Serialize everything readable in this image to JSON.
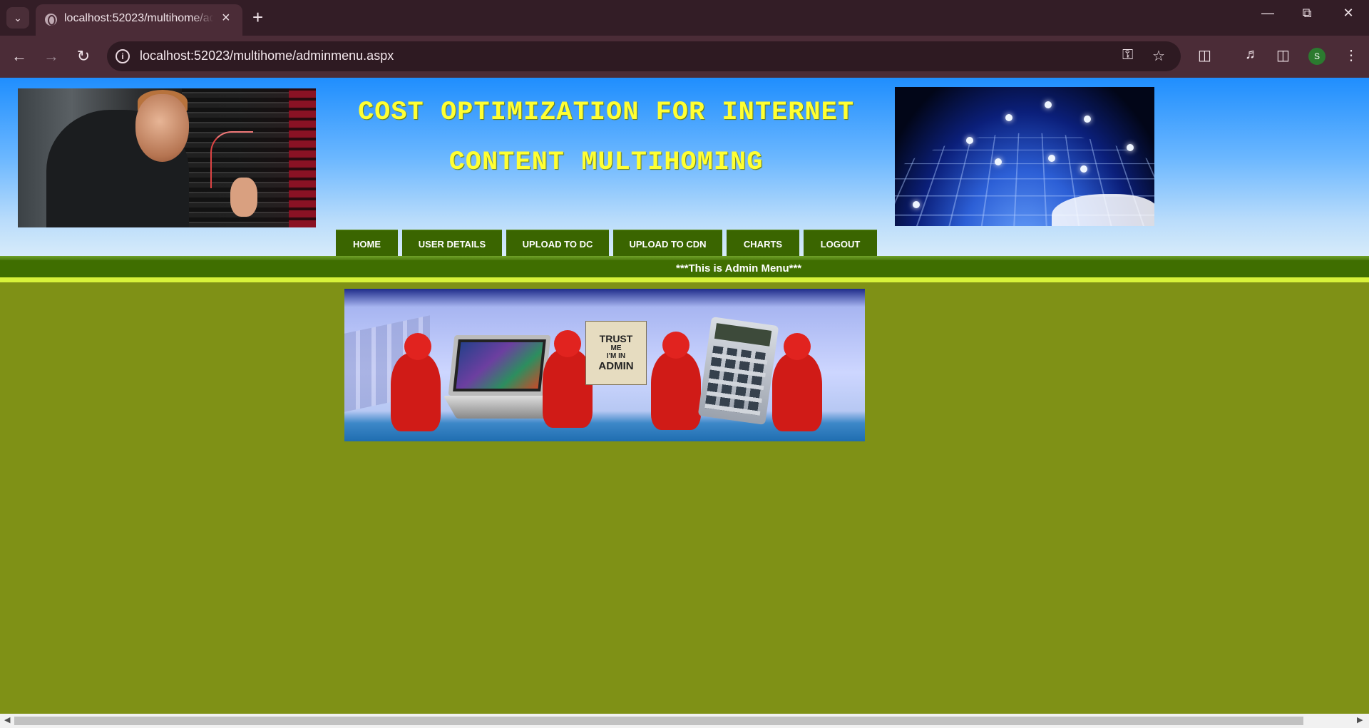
{
  "browser": {
    "tab_title": "localhost:52023/multihome/adminmenu.aspx",
    "url": "localhost:52023/multihome/adminmenu.aspx",
    "profile_initial": "S"
  },
  "header": {
    "title_line1": "COST OPTIMIZATION FOR INTERNET",
    "title_line2": "CONTENT MULTIHOMING"
  },
  "menu": {
    "items": [
      {
        "label": "HOME"
      },
      {
        "label": "USER DETAILS"
      },
      {
        "label": "UPLOAD TO DC"
      },
      {
        "label": "UPLOAD TO CDN"
      },
      {
        "label": "CHARTS"
      },
      {
        "label": "LOGOUT"
      }
    ]
  },
  "status_band": {
    "text": "***This is Admin Menu***"
  },
  "banner": {
    "sign_line1": "TRUST",
    "sign_line2": "ME",
    "sign_line3": "I'M IN",
    "sign_line4": "ADMIN"
  },
  "colors": {
    "page_bg": "#7f9116",
    "menu_bg": "#3a6500",
    "title_yellow": "#ffff33",
    "band_green": "#3f6e00",
    "band_light": "#d8f23a"
  },
  "icons": [
    "tab-search-icon",
    "globe-icon",
    "close-icon",
    "plus-icon",
    "back-icon",
    "forward-icon",
    "reload-icon",
    "site-info-icon",
    "key-icon",
    "star-icon",
    "extensions-icon",
    "media-icon",
    "sidebar-icon",
    "menu-icon"
  ]
}
